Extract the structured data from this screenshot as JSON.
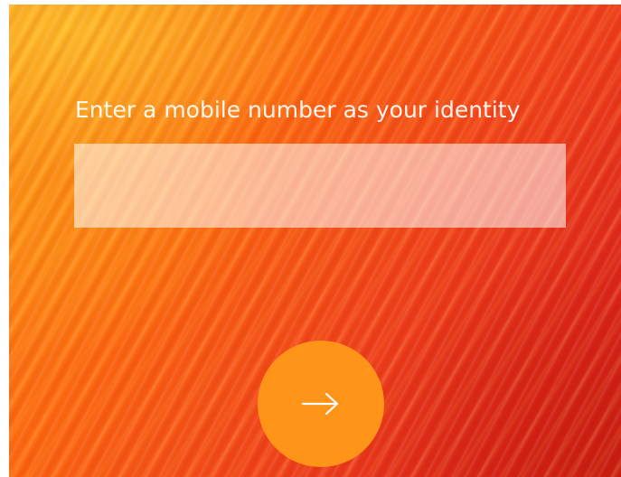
{
  "login": {
    "prompt": "Enter a mobile number as your identity",
    "input_value": "",
    "input_placeholder": "",
    "next_icon": "arrow-right-icon"
  },
  "colors": {
    "background_warm": "#ff9c1a",
    "background_deep": "#cf1f1f",
    "button": "#ff9418",
    "text": "#ffffff"
  }
}
